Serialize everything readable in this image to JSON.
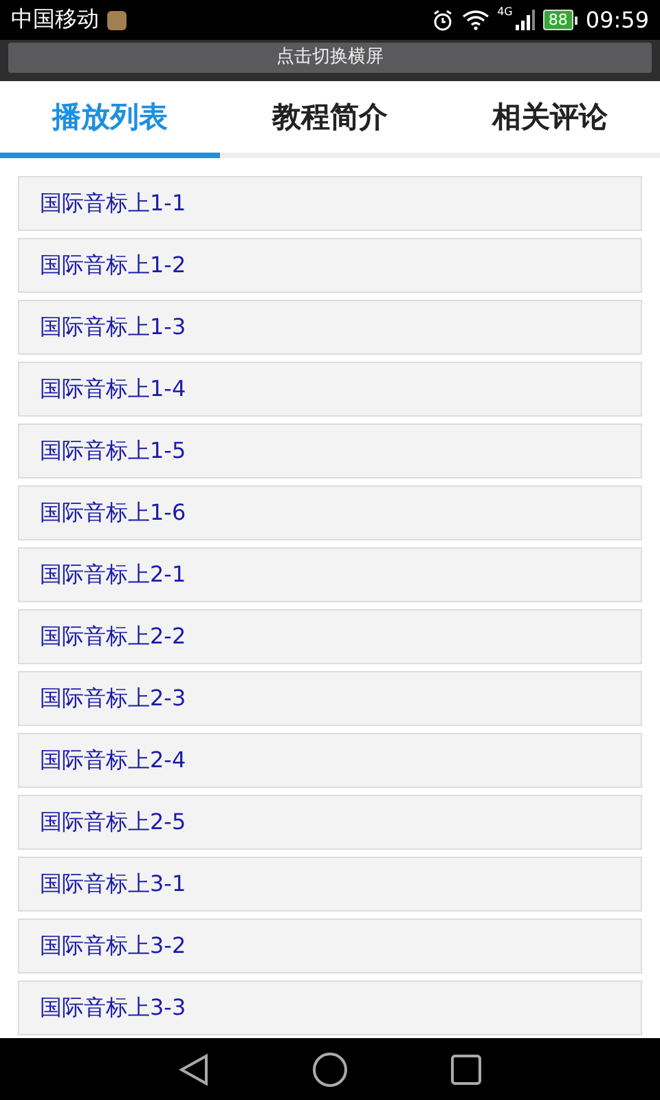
{
  "status_bar": {
    "carrier": "中国移动",
    "network": "4G",
    "battery": "88",
    "time": "09:59"
  },
  "rotate_banner": {
    "label": "点击切换横屏"
  },
  "tabs": [
    {
      "label": "播放列表",
      "selected": true
    },
    {
      "label": "教程简介",
      "selected": false
    },
    {
      "label": "相关评论",
      "selected": false
    }
  ],
  "playlist": [
    "国际音标上1-1",
    "国际音标上1-2",
    "国际音标上1-3",
    "国际音标上1-4",
    "国际音标上1-5",
    "国际音标上1-6",
    "国际音标上2-1",
    "国际音标上2-2",
    "国际音标上2-3",
    "国际音标上2-4",
    "国际音标上2-5",
    "国际音标上3-1",
    "国际音标上3-2",
    "国际音标上3-3"
  ]
}
